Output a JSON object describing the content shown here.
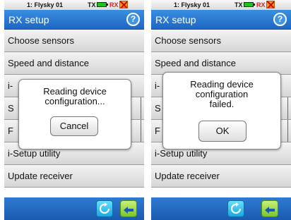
{
  "screens": [
    {
      "status": {
        "model": "1: Flysky 01",
        "tx": "TX",
        "rx": "RX"
      },
      "title": "RX setup",
      "help_glyph": "?",
      "menu": [
        "Choose sensors",
        "Speed and distance",
        "i-",
        "S",
        "F",
        "i-Setup utility",
        "Update receiver"
      ],
      "dialog": {
        "message": "Reading device configuration...",
        "button": "Cancel"
      }
    },
    {
      "status": {
        "model": "1: Flysky 01",
        "tx": "TX",
        "rx": "RX"
      },
      "title": "RX setup",
      "help_glyph": "?",
      "menu": [
        "Choose sensors",
        "Speed and distance",
        "i-",
        "S",
        "F",
        "i-Setup utility",
        "Update receiver"
      ],
      "dialog": {
        "message": "Reading device configuration failed.",
        "button": "OK"
      }
    }
  ],
  "icons": [
    "battery-icon",
    "no-signal-icon",
    "help-icon",
    "refresh-icon",
    "back-arrow-icon"
  ],
  "colors": {
    "title_bar": "#1e66c4",
    "battery": "#1ec21e",
    "rx_warning": "#e02020",
    "back_button": "#7bc62a",
    "refresh_button": "#1aa7e0"
  }
}
